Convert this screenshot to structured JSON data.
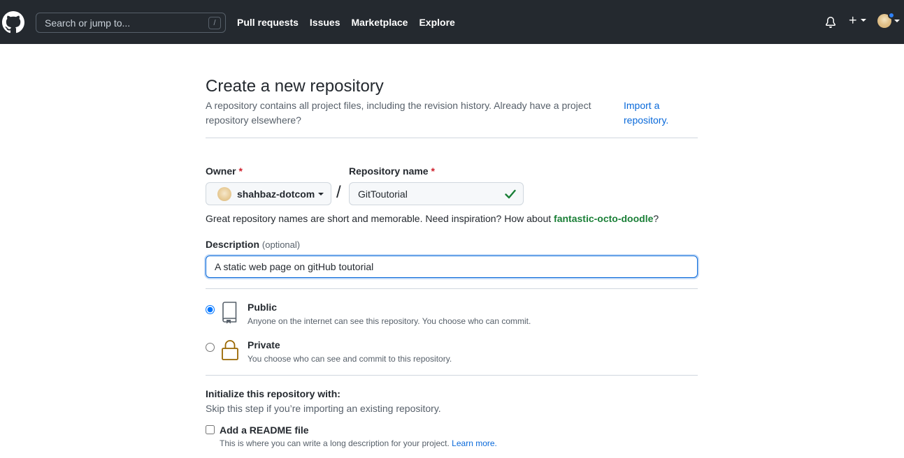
{
  "header": {
    "search_placeholder": "Search or jump to...",
    "search_shortcut": "/",
    "nav": [
      "Pull requests",
      "Issues",
      "Marketplace",
      "Explore"
    ],
    "plus_label": "+"
  },
  "page": {
    "title": "Create a new repository",
    "intro": "A repository contains all project files, including the revision history. Already have a project repository elsewhere?",
    "import_link": "Import a repository."
  },
  "form": {
    "owner_label": "Owner",
    "required_mark": "*",
    "owner_name": "shahbaz-dotcom",
    "separator": "/",
    "repo_label": "Repository name",
    "repo_value": "GitToutorial",
    "hint_prefix": "Great repository names are short and memorable. Need inspiration? How about ",
    "hint_suggestion": "fantastic-octo-doodle",
    "hint_suffix": "?",
    "description_label": "Description",
    "description_optional": "(optional)",
    "description_value": "A static web page on gitHub toutorial"
  },
  "visibility": {
    "selected": "public",
    "public_title": "Public",
    "public_desc": "Anyone on the internet can see this repository. You choose who can commit.",
    "private_title": "Private",
    "private_desc": "You choose who can see and commit to this repository."
  },
  "init": {
    "title": "Initialize this repository with:",
    "subtitle": "Skip this step if you’re importing an existing repository.",
    "readme_label": "Add a README file",
    "readme_desc": "This is where you can write a long description for your project.",
    "learn_more": "Learn more."
  },
  "colors": {
    "header_bg": "#24292f",
    "link": "#0969da",
    "success": "#1a7f37",
    "danger": "#cf222e"
  }
}
